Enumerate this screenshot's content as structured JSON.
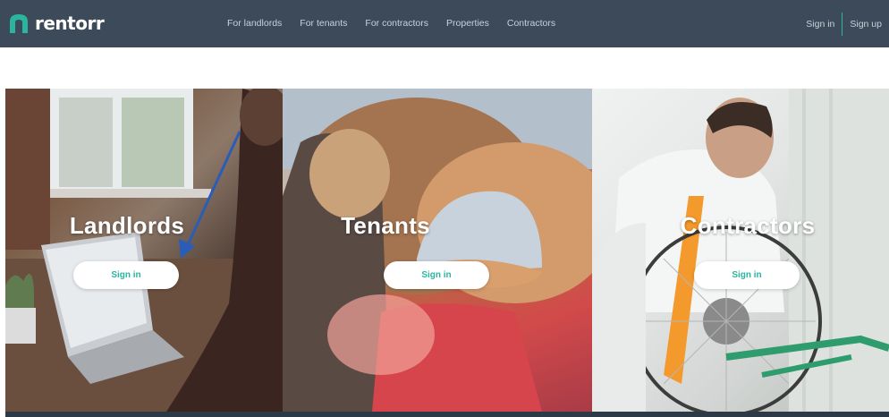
{
  "brand": {
    "name": "rentorr",
    "icon": "house-arch-icon",
    "accent": "#2bb5a0"
  },
  "nav": {
    "links": [
      "For landlords",
      "For tenants",
      "For contractors",
      "Properties",
      "Contractors"
    ],
    "sign_in": "Sign in",
    "sign_up": "Sign up",
    "background": "#3d4a59"
  },
  "panels": [
    {
      "title": "Landlords",
      "button": "Sign in"
    },
    {
      "title": "Tenants",
      "button": "Sign in"
    },
    {
      "title": "Contractors",
      "button": "Sign in"
    }
  ]
}
